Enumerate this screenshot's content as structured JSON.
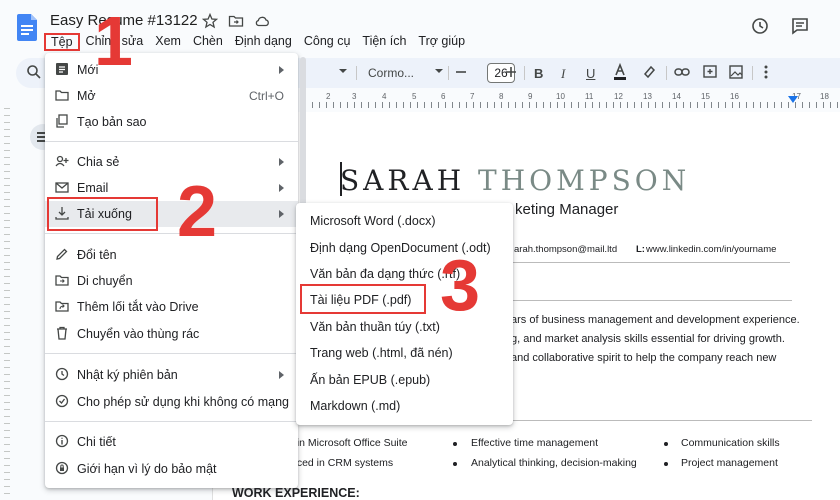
{
  "doc": {
    "title": "Easy Resume #13122"
  },
  "menubar": [
    "Tệp",
    "Chỉnh sửa",
    "Xem",
    "Chèn",
    "Định dạng",
    "Công cụ",
    "Tiện ích",
    "Trợ giúp"
  ],
  "toolbar": {
    "font_name": "Cormo...",
    "font_size": "26"
  },
  "ruler": [
    "2",
    "3",
    "4",
    "5",
    "6",
    "7",
    "8",
    "9",
    "10",
    "11",
    "12",
    "13",
    "14",
    "15",
    "16",
    "17",
    "18"
  ],
  "file_menu": [
    {
      "label": "Mới",
      "icon": "new-doc-icon",
      "submenu": true
    },
    {
      "label": "Mở",
      "icon": "folder-icon",
      "shortcut": "Ctrl+O"
    },
    {
      "label": "Tạo bản sao",
      "icon": "copy-icon"
    },
    {
      "label": "Chia sẻ",
      "icon": "share-icon",
      "submenu": true
    },
    {
      "label": "Email",
      "icon": "email-icon",
      "submenu": true
    },
    {
      "label": "Tải xuống",
      "icon": "download-icon",
      "submenu": true
    },
    {
      "label": "Đổi tên",
      "icon": "pencil-icon"
    },
    {
      "label": "Di chuyển",
      "icon": "move-folder-icon"
    },
    {
      "label": "Thêm lối tắt vào Drive",
      "icon": "drive-shortcut-icon"
    },
    {
      "label": "Chuyển vào thùng rác",
      "icon": "trash-icon"
    },
    {
      "label": "Nhật ký phiên bản",
      "icon": "history-icon",
      "submenu": true
    },
    {
      "label": "Cho phép sử dụng khi không có mạng",
      "icon": "offline-icon"
    },
    {
      "label": "Chi tiết",
      "icon": "info-icon"
    },
    {
      "label": "Giới hạn vì lý do bảo mật",
      "icon": "security-icon"
    }
  ],
  "download_menu": [
    "Microsoft Word (.docx)",
    "Định dạng OpenDocument (.odt)",
    "Văn bản đa dạng thức (.rtf)",
    "Tài liệu PDF (.pdf)",
    "Văn bản thuần túy (.txt)",
    "Trang web (.html, đã nén)",
    "Ấn bản EPUB (.epub)",
    "Markdown (.md)"
  ],
  "resume": {
    "first_name": "SARAH",
    "last_name": "THOMPSON",
    "role": "keting Manager",
    "contact_email": "arah.thompson@mail.ltd",
    "contact_linkedin_prefix": "L:",
    "contact_linkedin": "www.linkedin.com/in/yourname",
    "summary": [
      "ars of business management and development experience.",
      "g, and market analysis skills essential for driving growth.",
      "and collaborative spirit to help the company reach new"
    ],
    "skills": [
      "t in Microsoft Office Suite",
      "Effective time management",
      "Communication skills",
      "nced in CRM systems",
      "Analytical thinking, decision-making",
      "Project management"
    ],
    "work_heading": "WORK EXPERIENCE:"
  },
  "steps": [
    "1",
    "2",
    "3"
  ],
  "colors": {
    "accent_red": "#e53935",
    "docs_blue": "#4285f4"
  }
}
